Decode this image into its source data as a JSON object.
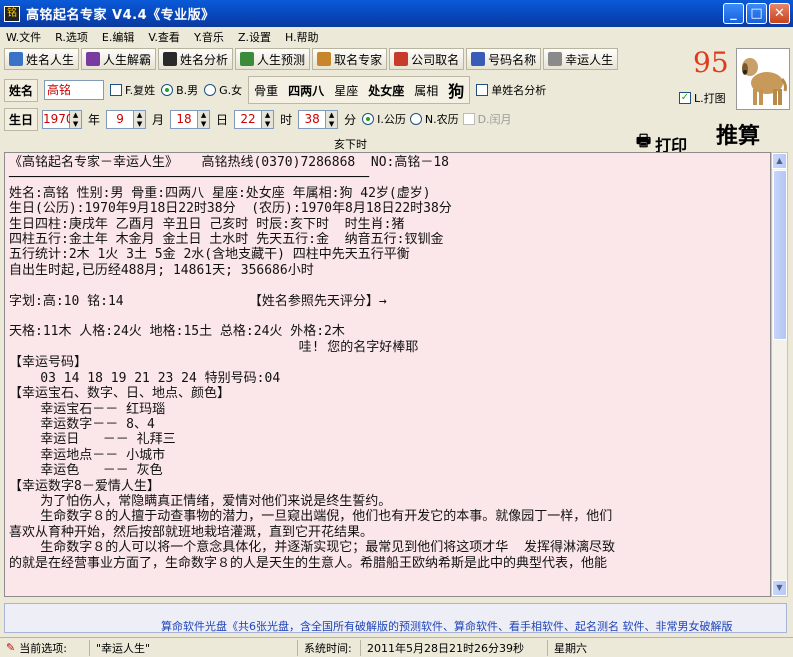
{
  "window": {
    "title": "高铭起名专家  V4.4《专业版》",
    "icon_char": "铭"
  },
  "menu": [
    "W.文件",
    "R.选项",
    "E.编辑",
    "V.查看",
    "Y.音乐",
    "Z.设置",
    "H.帮助"
  ],
  "toolbar": [
    "姓名人生",
    "人生解霸",
    "姓名分析",
    "人生预测",
    "取名专家",
    "公司取名",
    "号码名称",
    "幸运人生"
  ],
  "name_row": {
    "label": "姓名",
    "value": "高铭",
    "fuxing": "F.复姓",
    "male": "B.男",
    "female": "G.女",
    "bone_weight_label": "骨重",
    "bone_weight": "四两八",
    "constellation_label": "星座",
    "constellation": "处女座",
    "zodiac_label": "属相",
    "zodiac": "狗",
    "single_name": "单姓名分析"
  },
  "birth_row": {
    "label": "生日",
    "year": "1970",
    "year_unit": "年",
    "month": "9",
    "month_unit": "月",
    "day": "18",
    "day_unit": "日",
    "hour": "22",
    "hour_unit": "时",
    "minute": "38",
    "minute_unit": "分",
    "solar": "I.公历",
    "lunar": "N.农历",
    "leap": "D.闰月"
  },
  "shichen": "亥下时",
  "score": "95",
  "print_checkbox": "L.打图",
  "print_button": "打印",
  "calc_button": "推算",
  "content_lines": [
    "《高铭起名专家－幸运人生》   高铭热线(0370)7286868  NO:高铭－18",
    "──────────────────────────────────────────────",
    "姓名:高铭 性别:男 骨重:四两八 星座:处女座 年属相:狗 42岁(虚岁)",
    "生日(公历):1970年9月18日22时38分  (农历):1970年8月18日22时38分",
    "生日四柱:庚戌年 乙酉月 辛丑日 己亥时 时辰:亥下时  时生肖:猪",
    "四柱五行:金土年 木金月 金土日 土水时 先天五行:金  纳音五行:钗钏金",
    "五行统计:2木 1火 3土 5金 2水(含地支藏干) 四柱中先天五行平衡",
    "自出生时起,已历经488月; 14861天; 356686小时",
    "",
    "字划:高:10 铭:14                【姓名参照先天评分】→",
    "",
    "天格:11木 人格:24火 地格:15土 总格:24火 外格:2木",
    "                                     哇! 您的名字好棒耶",
    "【幸运号码】",
    "    03 14 18 19 21 23 24 特别号码:04",
    "【幸运宝石、数字、日、地点、颜色】",
    "    幸运宝石－－ 红玛瑙",
    "    幸运数字－－ 8、4",
    "    幸运日   －－ 礼拜三",
    "    幸运地点－－ 小城市",
    "    幸运色   －－ 灰色",
    "【幸运数字8－爱情人生】",
    "    为了怕伤人，常隐瞒真正情绪，爱情对他们来说是终生誓约。",
    "    生命数字８的人擅于动查事物的潜力，一旦窥出端倪，他们也有开发它的本事。就像园丁一样，他们",
    "喜欢从育种开始，然后按部就班地栽培灌溉，直到它开花结果。",
    "    生命数字８的人可以将一个意念具体化，并逐渐实现它；最常见到他们将这项才华  发挥得淋漓尽致",
    "的就是在经营事业方面了，生命数字８的人是天生的生意人。希腊船王欧纳希斯是此中的典型代表，他能"
  ],
  "ticker": "算命软件光盘《共6张光盘，含全国所有破解版的预测软件、算命软件、看手相软件、起名测名 软件、非常男女破解版",
  "status": {
    "current_label": "当前选项:",
    "current_value": "\"幸运人生\"",
    "time_label": "系统时间:",
    "time_value": "2011年5月28日21时26分39秒",
    "weekday": "星期六"
  }
}
